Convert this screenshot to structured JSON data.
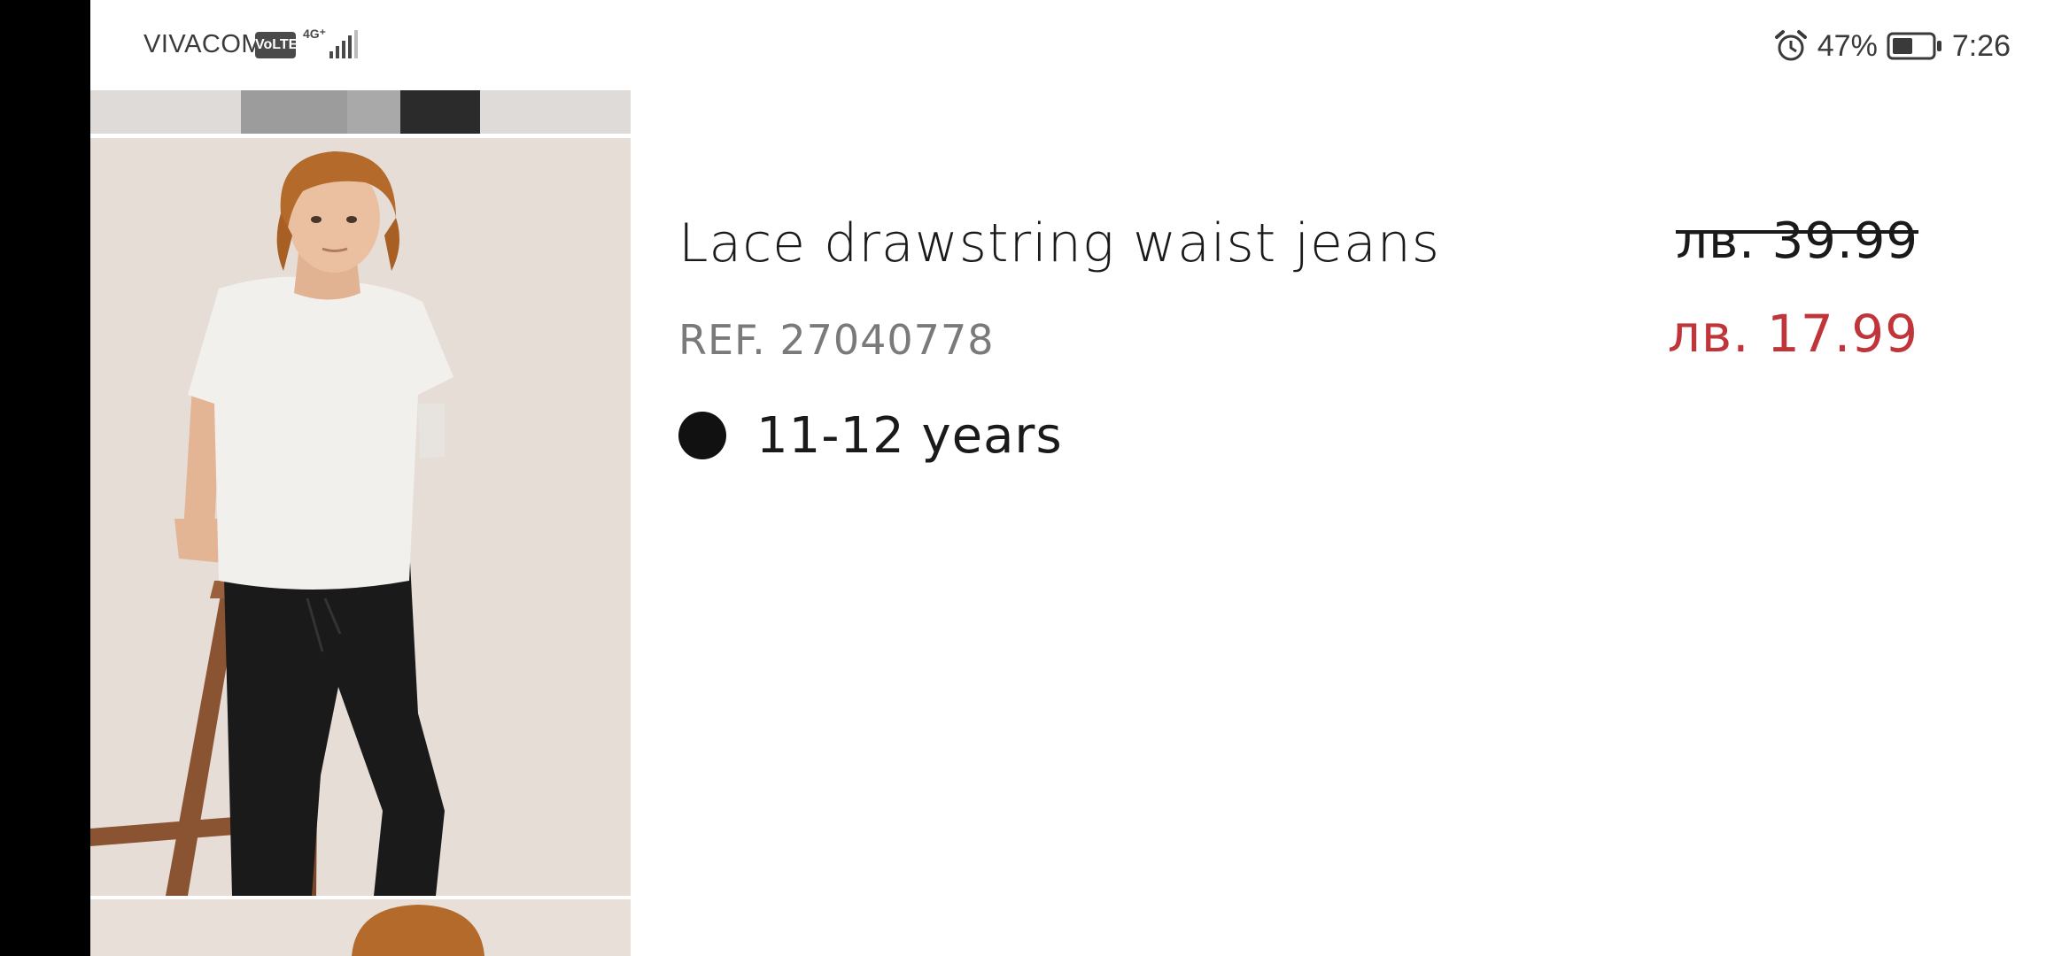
{
  "status_bar": {
    "carrier": "VIVACOM",
    "volte": "VoLTE",
    "network_type": "4G⁺",
    "battery_percent": "47%",
    "time": "7:26",
    "icons": [
      "alarm-icon",
      "battery-icon",
      "signal-icon"
    ]
  },
  "product": {
    "title": "Lace drawstring waist jeans",
    "reference": "REF. 27040778",
    "color_swatch": "#111111",
    "size": "11-12 years",
    "price_original": "лв. 39.99",
    "price_sale": "лв. 17.99",
    "sale_color": "#c0353a"
  },
  "gallery": {
    "images": [
      "product-photo-previous",
      "product-photo-main",
      "product-photo-next"
    ]
  }
}
